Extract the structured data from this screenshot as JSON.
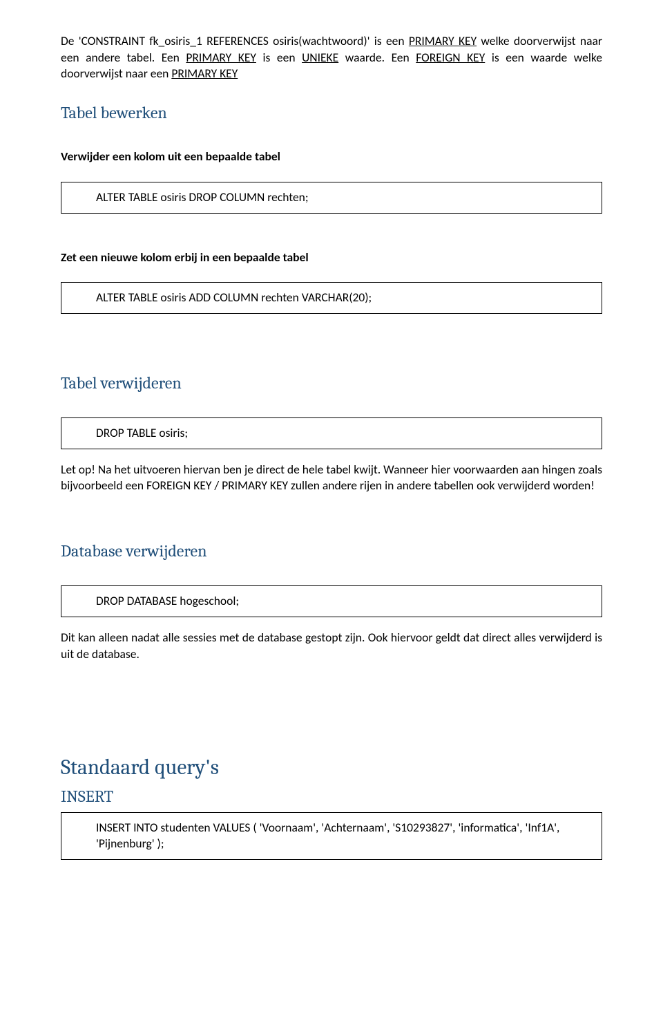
{
  "intro": {
    "p1_a": "De 'CONSTRAINT fk_osiris_1 REFERENCES osiris(wachtwoord)' is een ",
    "p1_u1": "PRIMARY KEY",
    "p1_b": " welke doorverwijst naar een andere tabel. Een ",
    "p1_u2": "PRIMARY KEY",
    "p1_c": " is een ",
    "p1_u3": "UNIEKE",
    "p1_d": " waarde. Een ",
    "p1_u4": "FOREIGN KEY",
    "p1_e": " is een waarde welke doorverwijst naar een ",
    "p1_u5": "PRIMARY KEY"
  },
  "sections": {
    "bewerken": {
      "title": "Tabel bewerken",
      "sub1": "Verwijder een kolom uit een bepaalde tabel",
      "code1": "ALTER TABLE osiris DROP COLUMN rechten;",
      "sub2": "Zet een nieuwe kolom erbij in een bepaalde tabel",
      "code2": "ALTER TABLE osiris ADD COLUMN rechten VARCHAR(20);"
    },
    "verwijderen": {
      "title": "Tabel verwijderen",
      "code": "DROP TABLE osiris;",
      "note": "Let op! Na het uitvoeren hiervan ben je direct de hele tabel kwijt. Wanneer hier voorwaarden aan hingen zoals bijvoorbeeld een FOREIGN KEY / PRIMARY KEY zullen andere rijen in andere tabellen ook verwijderd worden!"
    },
    "db_verwijderen": {
      "title": "Database verwijderen",
      "code": "DROP DATABASE hogeschool;",
      "note": "Dit kan alleen nadat alle sessies met de database gestopt zijn. Ook hiervoor geldt dat direct alles verwijderd is uit de database."
    },
    "standaard": {
      "title": "Standaard query's",
      "insert_title": "INSERT",
      "insert_code_line1": "INSERT INTO studenten VALUES ( 'Voornaam', 'Achternaam', 'S10293827', 'informatica', 'Inf1A',",
      "insert_code_line2": "'Pijnenburg' );"
    }
  }
}
